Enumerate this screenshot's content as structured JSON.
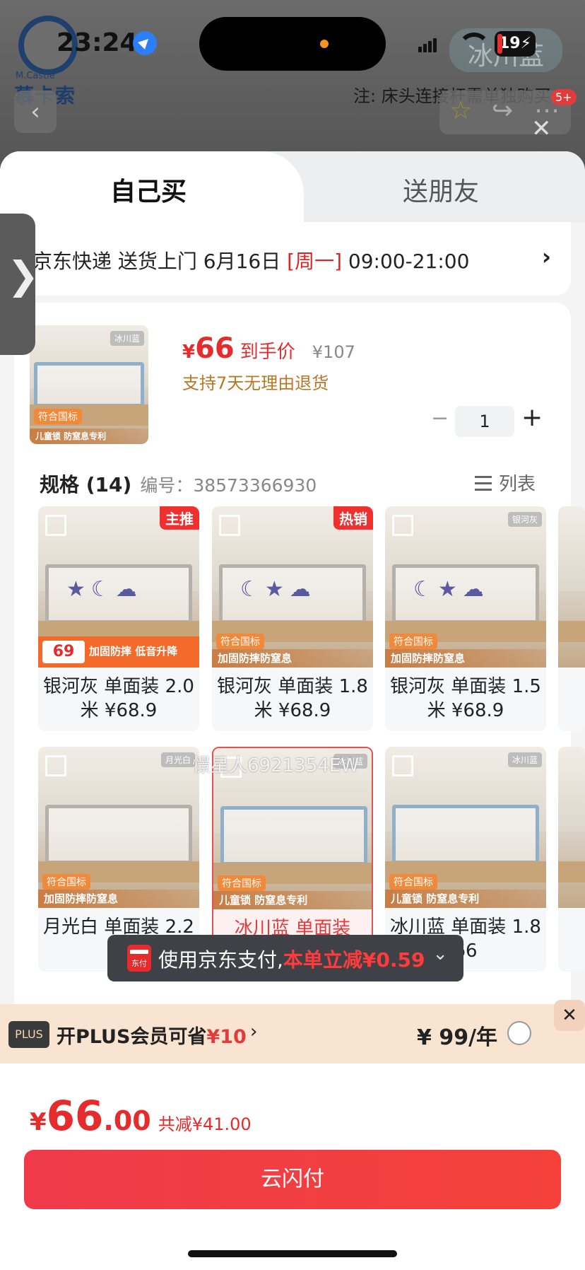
{
  "status": {
    "time": "23:24",
    "battery": "19"
  },
  "bg": {
    "brand_en": "M.Castle",
    "brand_cn": "慕卡索",
    "tag": "冰川蓝",
    "note": "注: 床头连接杆需单独购买",
    "badge": "5+"
  },
  "tabs": {
    "self": "自己买",
    "gift": "送朋友"
  },
  "delivery": {
    "prefix": "京东快递 送货上门 6月16日 ",
    "weekday": "[周一]",
    "time": " 09:00-21:00"
  },
  "product": {
    "currency": "¥",
    "price": "66",
    "price_label": "到手价",
    "original": "¥107",
    "return_policy": "支持7天无理由退货",
    "quantity": "1",
    "image_tag": "冰川蓝",
    "image_badge": "符合国标",
    "image_foot": "儿童锁 防窒息专利"
  },
  "spec": {
    "title": "规格 (14)",
    "code": "编号：38573366930",
    "list_label": "列表"
  },
  "tiles": [
    {
      "name": "银河灰 单面装 2.0米 ¥68.9",
      "badge": "主推",
      "promo_price": "69",
      "promo_text": "加固防摔 低音升降"
    },
    {
      "name": "银河灰 单面装 1.8米 ¥68.9",
      "badge": "热销",
      "foot1": "符合国标",
      "foot2": "加固防摔防窒息"
    },
    {
      "name": "银河灰 单面装 1.5米 ¥68.9",
      "tag": "银河灰",
      "foot1": "符合国标",
      "foot2": "加固防摔防窒息"
    },
    {
      "name": "月光白 单面装 2.2米",
      "tag": "月光白",
      "foot1": "符合国标",
      "foot2": "加固防摔防窒息"
    },
    {
      "name": "冰川蓝 单面装 2.0",
      "tag": "冰川蓝",
      "foot1": "符合国标",
      "foot2": "儿童锁 防窒息专利"
    },
    {
      "name": "冰川蓝 单面装 1.8 66",
      "tag": "冰川蓝",
      "foot1": "符合国标",
      "foot2": "儿童锁 防窒息专利"
    }
  ],
  "watermark": "憬星人6921354EW",
  "toast": {
    "jd_label": "东付",
    "text": "使用京东支付,",
    "highlight": "本单立减¥0.59"
  },
  "plus": {
    "tag": "PLUS",
    "text": "开PLUS会员可省",
    "save": "¥10",
    "price": "¥ 99/年"
  },
  "total": {
    "currency": "¥",
    "int": "66",
    "dec": ".00",
    "saved": "共减¥41.00"
  },
  "pay_button": "云闪付"
}
